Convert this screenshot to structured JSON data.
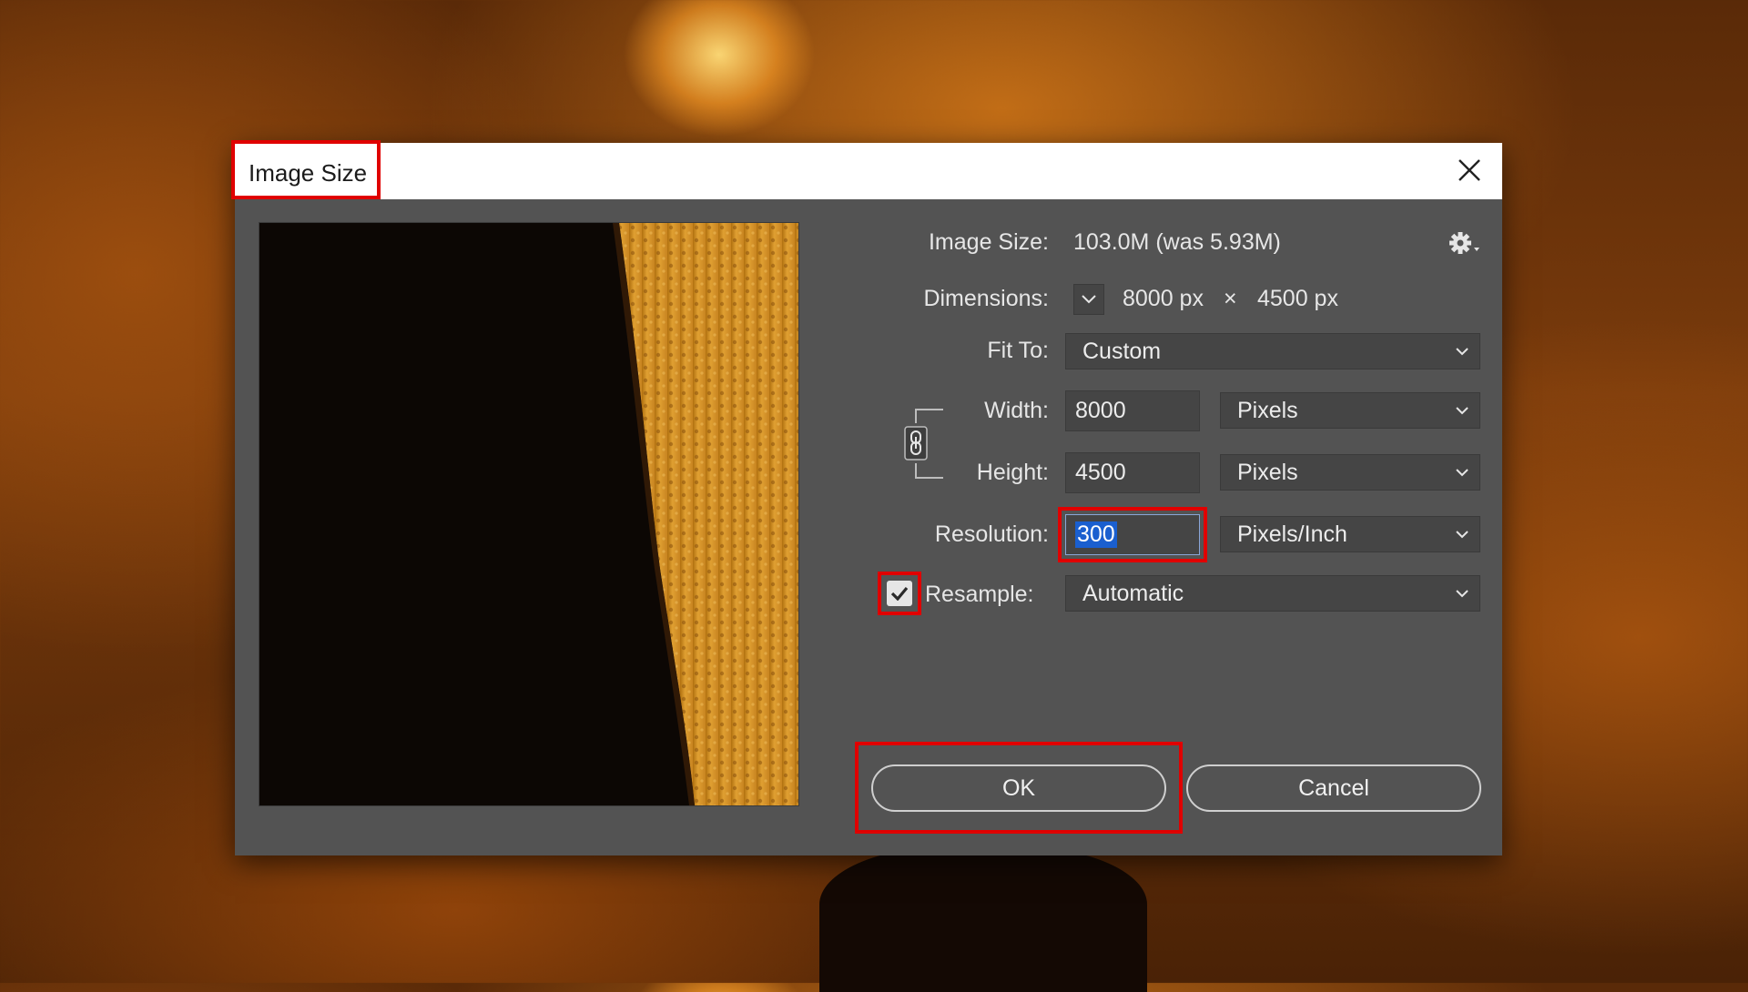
{
  "dialog": {
    "title": "Image Size",
    "image_size_label": "Image Size:",
    "image_size_value": "103.0M (was 5.93M)",
    "dimensions_label": "Dimensions:",
    "dimensions_width": "8000 px",
    "dimensions_sep": "×",
    "dimensions_height": "4500 px",
    "fit_to_label": "Fit To:",
    "fit_to_value": "Custom",
    "width_label": "Width:",
    "width_value": "8000",
    "width_unit": "Pixels",
    "height_label": "Height:",
    "height_value": "4500",
    "height_unit": "Pixels",
    "resolution_label": "Resolution:",
    "resolution_value": "300",
    "resolution_unit": "Pixels/Inch",
    "resample_label": "Resample:",
    "resample_checked": true,
    "resample_value": "Automatic",
    "ok_label": "OK",
    "cancel_label": "Cancel"
  },
  "icons": {
    "close": "close-icon",
    "gear": "gear-icon",
    "link": "link-icon",
    "chevron": "chevron-down-icon",
    "checkmark": "checkmark-icon"
  },
  "colors": {
    "dialog_bg": "#535353",
    "field_bg": "#454545",
    "highlight": "#e00000",
    "selection": "#1a5fcf"
  }
}
